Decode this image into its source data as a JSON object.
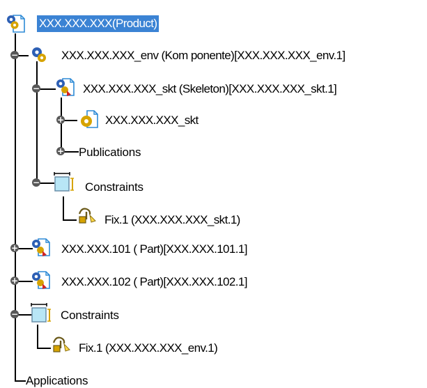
{
  "tree": {
    "root": {
      "label": "XXX.XXX.XXX(Product)",
      "icon": "product-icon",
      "selected": true
    },
    "env_component": {
      "label": "XXX.XXX.XXX_env (Kom ponente)[XXX.XXX.XXX_env.1]",
      "icon": "component-icon"
    },
    "skeleton": {
      "label": "XXX.XXX.XXX_skt (Skeleton)[XXX.XXX.XXX_skt.1]",
      "icon": "part-icon"
    },
    "skeleton_body": {
      "label": "XXX.XXX.XXX_skt",
      "icon": "geometry-icon"
    },
    "publications": {
      "label": "Publications"
    },
    "env_constraints": {
      "label": "Constraints",
      "icon": "constraints-icon"
    },
    "env_fix": {
      "label": "Fix.1 (XXX.XXX.XXX_skt.1)",
      "icon": "fix-constraint-icon"
    },
    "part_101": {
      "label": "XXX.XXX.101 ( Part)[XXX.XXX.101.1]",
      "icon": "part-icon"
    },
    "part_102": {
      "label": "XXX.XXX.102 ( Part)[XXX.XXX.102.1]",
      "icon": "part-icon"
    },
    "root_constraints": {
      "label": "Constraints",
      "icon": "constraints-icon"
    },
    "root_fix": {
      "label": "Fix.1 (XXX.XXX.XXX_env.1)",
      "icon": "fix-constraint-icon"
    },
    "applications": {
      "label": "Applications"
    }
  },
  "colors": {
    "selection": "#3b83d4",
    "tree_line": "#000000",
    "toggle": "#585858",
    "gear_blue": "#2d5fb4",
    "gear_gold": "#d6a300",
    "part_red": "#d22323",
    "constraint_cyan": "#b8e6f6"
  }
}
